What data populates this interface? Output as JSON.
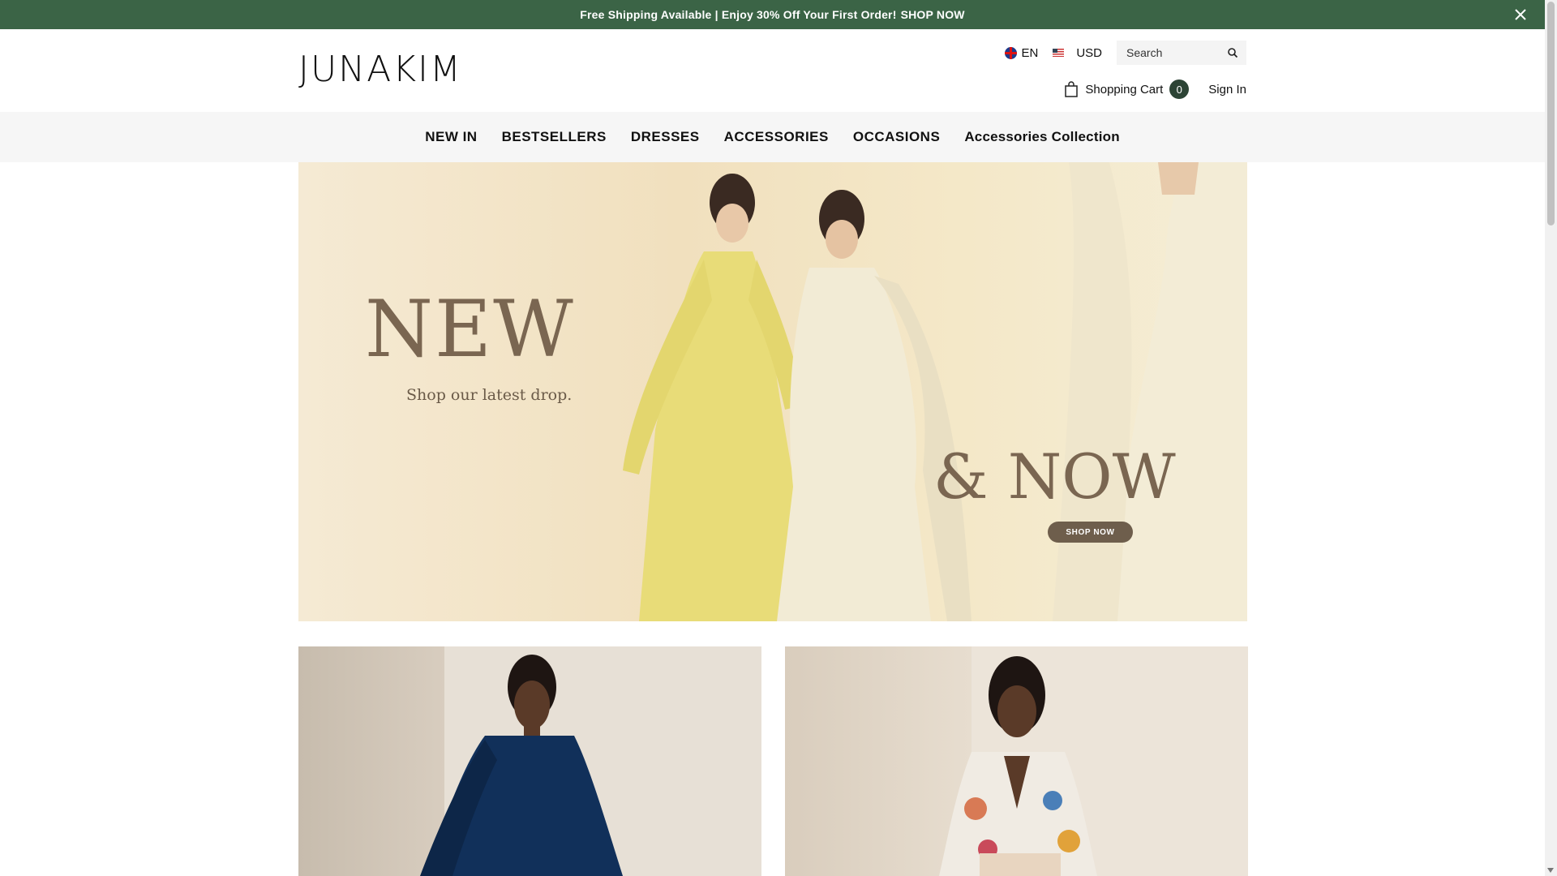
{
  "announcement": {
    "text": "Free Shipping Available | Enjoy 30% Off Your First Order!",
    "link": "SHOP NOW"
  },
  "header": {
    "logo": "JUNAKIM",
    "language": "EN",
    "currency": "USD",
    "search_placeholder": "Search",
    "cart_label": "Shopping Cart",
    "cart_count": "0",
    "sign_in": "Sign In"
  },
  "nav": {
    "items": [
      "NEW IN",
      "BESTSELLERS",
      "DRESSES",
      "ACCESSORIES",
      "OCCASIONS",
      "Accessories Collection"
    ]
  },
  "hero": {
    "headline": "NEW",
    "subhead": "Shop our latest drop.",
    "tagline": "& NOW",
    "cta": "SHOP NOW"
  }
}
